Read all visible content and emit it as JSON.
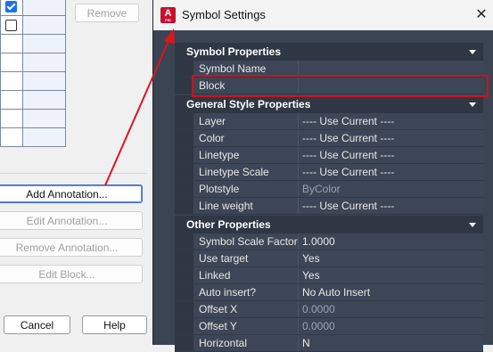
{
  "background_dialog": {
    "rows": [
      {
        "checked": true
      },
      {
        "checked": false
      },
      {
        "checked": null
      },
      {
        "checked": null
      },
      {
        "checked": null
      },
      {
        "checked": null
      },
      {
        "checked": null
      },
      {
        "checked": null
      }
    ],
    "remove_label": "Remove",
    "add_annotation_label": "Add Annotation...",
    "edit_annotation_label": "Edit Annotation...",
    "remove_annotation_label": "Remove Annotation...",
    "edit_block_label": "Edit Block...",
    "cancel_label": "Cancel",
    "help_label": "Help"
  },
  "window": {
    "title": "Symbol Settings",
    "app_icon": "autocad-icon",
    "app_icon_letter": "A",
    "app_icon_sub": "PID",
    "close_icon": "close-icon"
  },
  "sections": [
    {
      "title": "Symbol Properties",
      "rows": [
        {
          "name": "Symbol Name",
          "value": "",
          "dim": false
        },
        {
          "name": "Block",
          "value": "",
          "dim": false
        }
      ]
    },
    {
      "title": "General Style Properties",
      "rows": [
        {
          "name": "Layer",
          "value": "---- Use Current ----",
          "dim": false
        },
        {
          "name": "Color",
          "value": "---- Use Current ----",
          "dim": false
        },
        {
          "name": "Linetype",
          "value": "---- Use Current ----",
          "dim": false
        },
        {
          "name": "Linetype Scale",
          "value": "---- Use Current ----",
          "dim": false
        },
        {
          "name": "Plotstyle",
          "value": "ByColor",
          "dim": true
        },
        {
          "name": "Line weight",
          "value": "---- Use Current ----",
          "dim": false
        }
      ]
    },
    {
      "title": "Other Properties",
      "rows": [
        {
          "name": "Symbol Scale Factor",
          "value": "1.0000",
          "dim": false
        },
        {
          "name": "Use target properties",
          "value": "Yes",
          "dim": false
        },
        {
          "name": "Linked",
          "value": "Yes",
          "dim": false
        },
        {
          "name": "Auto insert?",
          "value": "No Auto Insert",
          "dim": false
        },
        {
          "name": "Offset X",
          "value": "0.0000",
          "dim": true
        },
        {
          "name": "Offset Y",
          "value": "0.0000",
          "dim": true
        },
        {
          "name": "Horizontal",
          "value": "N",
          "dim": false
        }
      ]
    }
  ],
  "colors": {
    "highlight": "#c8141e",
    "arrow": "#e0141e",
    "panel": "#3b4453",
    "accent": "#1a73e8"
  }
}
